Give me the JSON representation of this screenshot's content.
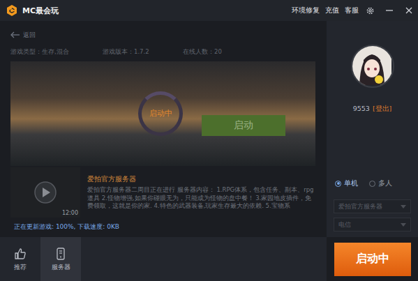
{
  "window": {
    "title": "MC最会玩",
    "menu": [
      "环境修复",
      "充值",
      "客服"
    ]
  },
  "back": {
    "label": "返回"
  },
  "game_info": [
    "游戏类型：生存,混合",
    "游戏版本：1.7.2",
    "在线人数：20"
  ],
  "banner": {
    "status": "启动中",
    "button": {
      "label": "启动",
      "disabled": true
    }
  },
  "video": {
    "duration": "12:00"
  },
  "server": {
    "title": "爱拍官方服务器",
    "description": "爱拍官方服务器二周目正在进行 服务器内容： 1.RPG体系，包含任务、副本、rpg道具 2.怪物增强,如果你碰眼无为，只能成为怪物的盘中餐！ 3.家园地皮插件，免费领取，这就是你的家. 4.特色的武器装备,玩家生存最大的依赖. 5.宝物系"
  },
  "status_line": "正在更新游戏: 100%, 下载速度: 0KB",
  "user": {
    "name": "9553",
    "logout": "[登出]"
  },
  "modes": [
    {
      "label": "单机",
      "selected": true
    },
    {
      "label": "多人",
      "selected": false
    }
  ],
  "selects": [
    {
      "value": "爱拍官方服务器",
      "disabled": true
    },
    {
      "value": "电信",
      "disabled": true
    }
  ],
  "nav": [
    {
      "label": "推荐",
      "selected": false,
      "kind": "thumbs"
    },
    {
      "label": "服务器",
      "selected": true,
      "kind": "phone"
    }
  ],
  "launch_button": {
    "label": "启动中"
  }
}
